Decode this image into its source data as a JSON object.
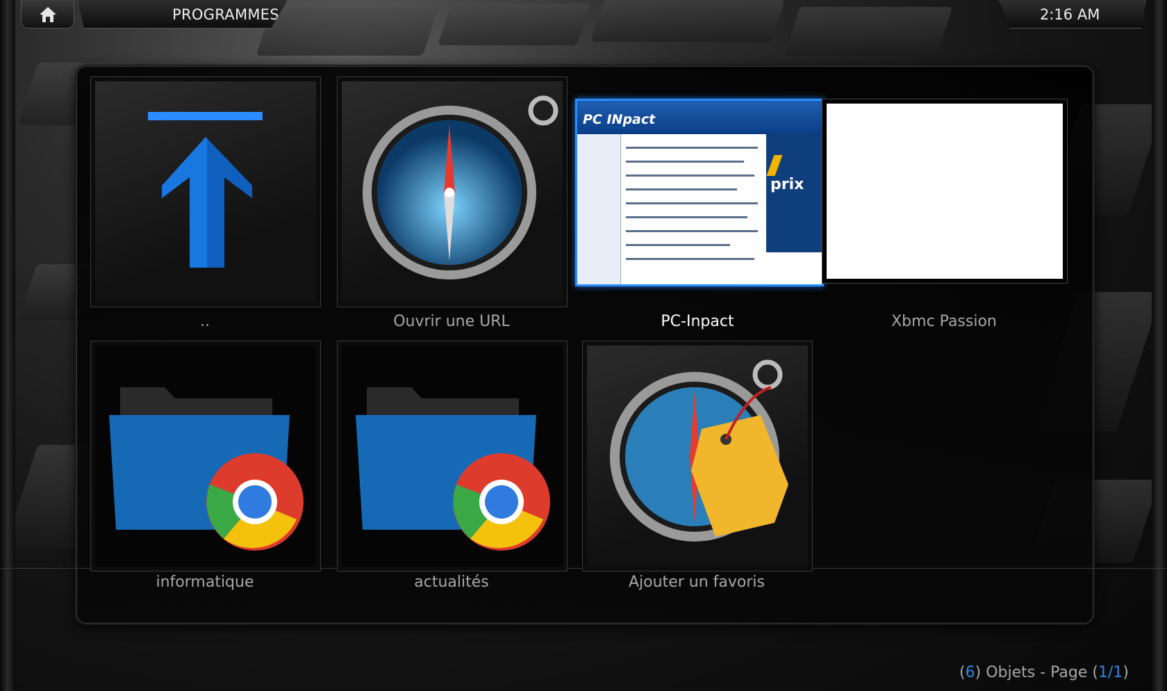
{
  "header": {
    "title": "PROGRAMMES",
    "clock": "2:16 AM"
  },
  "tiles": [
    {
      "label": ".."
    },
    {
      "label": "Ouvrir une URL"
    },
    {
      "label": "PC-Inpact"
    },
    {
      "label": "Xbmc Passion"
    },
    {
      "label": "informatique"
    },
    {
      "label": "actualités"
    },
    {
      "label": "Ajouter un favoris"
    }
  ],
  "thumbnail": {
    "logo": "PC INpact",
    "ad_text": "prix"
  },
  "footer": {
    "open1": "(",
    "count": "6",
    "close1": ") Objets - Page (",
    "page": "1/1",
    "close2": ")"
  },
  "colors": {
    "accent": "#2a8cff",
    "label": "#a8a8a8",
    "label_focused": "#ffffff"
  }
}
